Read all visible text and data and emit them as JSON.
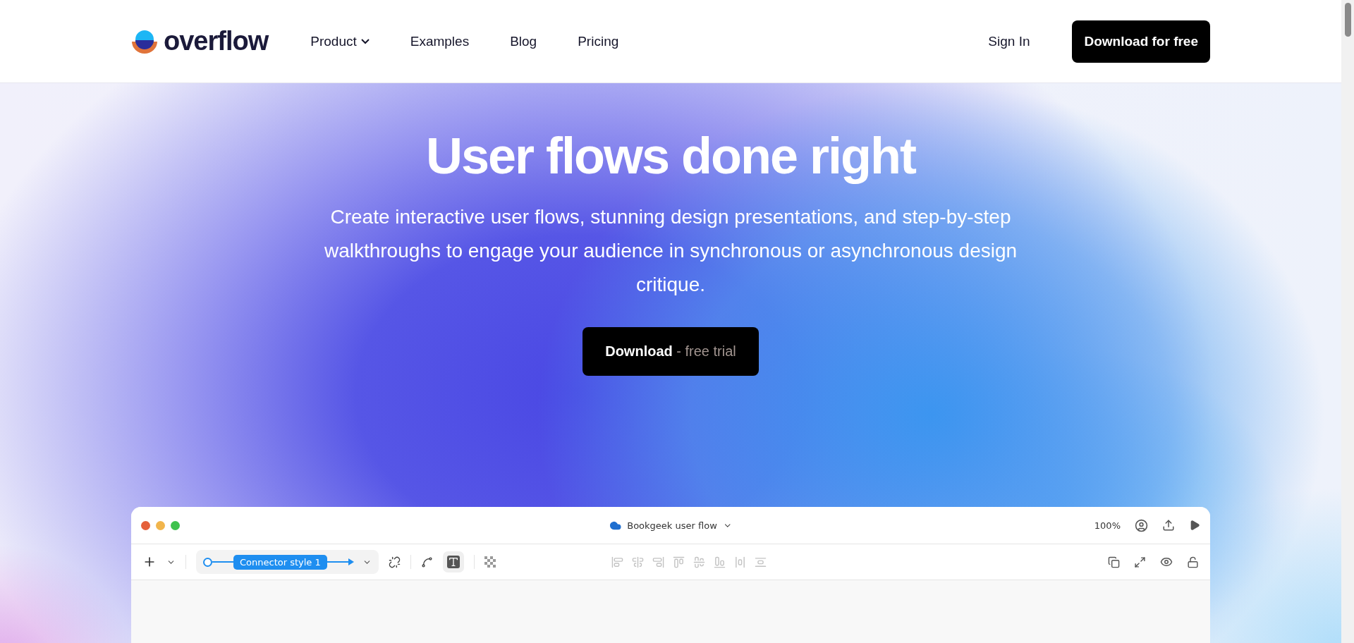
{
  "header": {
    "logo": "overflow",
    "nav": [
      {
        "label": "Product",
        "dropdown": true
      },
      {
        "label": "Examples",
        "dropdown": false
      },
      {
        "label": "Blog",
        "dropdown": false
      },
      {
        "label": "Pricing",
        "dropdown": false
      }
    ],
    "sign_in": "Sign In",
    "cta": "Download for free"
  },
  "hero": {
    "title": "User flows done right",
    "subtitle": "Create interactive user flows, stunning design presentations, and step-by-step walkthroughs to engage your audience in synchronous or asynchronous design critique.",
    "button": "**Download** - free trial"
  },
  "app_window": {
    "title": "Bookgeek user flow",
    "zoom": "100%",
    "connector_label": "Connector style 1",
    "text_tool_selected": true
  }
}
